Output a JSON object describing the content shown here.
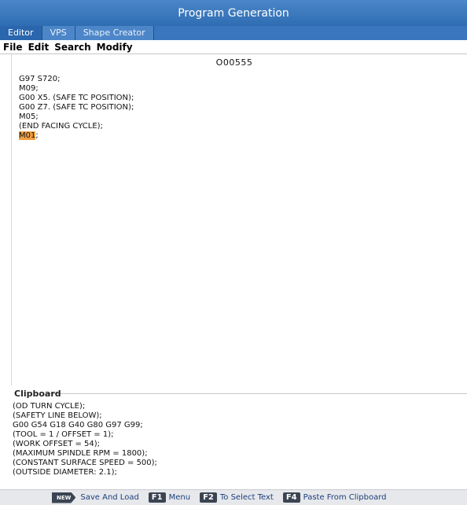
{
  "window": {
    "title": "Program Generation"
  },
  "tabs": [
    {
      "label": "Editor",
      "active": true
    },
    {
      "label": "VPS",
      "active": false
    },
    {
      "label": "Shape Creator",
      "active": false
    }
  ],
  "menu": [
    "File",
    "Edit",
    "Search",
    "Modify"
  ],
  "editor": {
    "program_name": "O00555",
    "lines": [
      "G97 S720;",
      "M09;",
      "G00 X5. (SAFE TC POSITION);",
      "G00 Z7. (SAFE TC POSITION);",
      "M05;",
      "(END FACING CYCLE);"
    ],
    "highlight_word": "M01",
    "highlight_suffix": ";"
  },
  "clipboard": {
    "title": "Clipboard",
    "lines": [
      "(OD TURN CYCLE);",
      "(SAFETY LINE BELOW);",
      "G00 G54 G18 G40 G80 G97 G99;",
      "(TOOL = 1 / OFFSET = 1);",
      "(WORK OFFSET = 54);",
      "(MAXIMUM SPINDLE RPM = 1800);",
      "(CONSTANT SURFACE SPEED = 500);",
      "(OUTSIDE DIAMETER: 2.1);"
    ]
  },
  "footer": {
    "new_key": "NEW",
    "items": [
      {
        "key": "",
        "label": "Save And Load"
      },
      {
        "key": "F1",
        "label": "Menu"
      },
      {
        "key": "F2",
        "label": "To Select Text"
      },
      {
        "key": "F4",
        "label": "Paste From Clipboard"
      }
    ]
  },
  "colors": {
    "title_bar": "#2f6db3",
    "highlight": "#f1a043"
  }
}
